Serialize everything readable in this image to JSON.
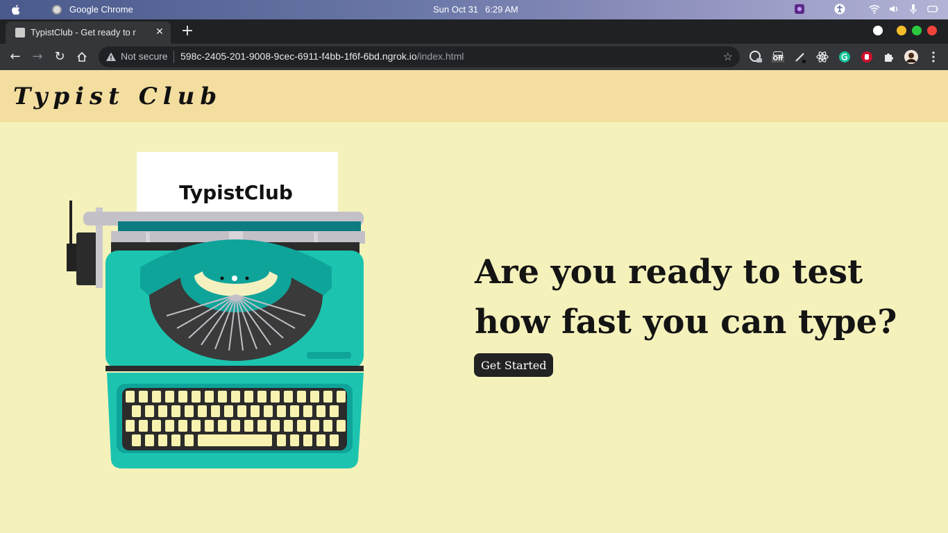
{
  "os": {
    "app_name": "Google Chrome",
    "date": "Sun Oct 31",
    "time": "6:29 AM"
  },
  "browser": {
    "tab_title": "TypistClub - Get ready to r",
    "new_tab_label": "+",
    "not_secure": "Not secure",
    "url_host": "598c-2405-201-9008-9cec-6911-f4bb-1f6f-6bd.ngrok.io",
    "url_path": "/index.html",
    "extension_off_badge": "Off"
  },
  "page": {
    "logo": "Typist Club",
    "illustration_text": "TypistClub",
    "headline": "Are you ready to test how fast you can type?",
    "cta_label": "Get Started"
  },
  "colors": {
    "header_bg": "#f3dea0",
    "page_bg": "#f4f1bb",
    "typewriter_teal": "#1cc4b0",
    "button_bg": "#222222"
  }
}
